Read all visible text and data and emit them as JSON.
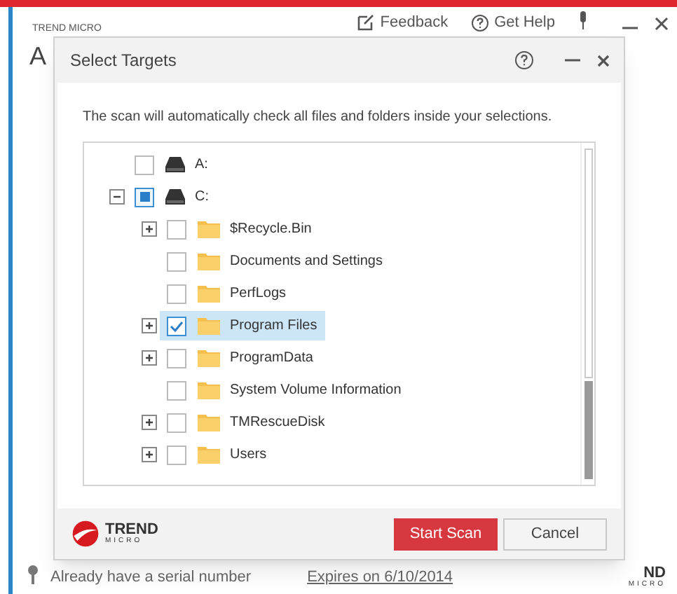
{
  "background_window": {
    "brand": "TREND MICRO",
    "title": "A",
    "header_links": [
      {
        "kind": "feedback",
        "label": "Feedback"
      },
      {
        "kind": "help",
        "label": "Get Help"
      }
    ],
    "serial_link": "Already have a serial number",
    "expiry": "Expires on 6/10/2014",
    "logo_text": "ND",
    "logo_subtext": "MICRO"
  },
  "dialog": {
    "title": "Select Targets",
    "description": "The scan will automatically check all files and folders inside your selections.",
    "tree": [
      {
        "kind": "drive",
        "label": "A:",
        "checked": false,
        "selected": false
      },
      {
        "kind": "drive",
        "label": "C:",
        "checked": false,
        "partial": true,
        "selected": false,
        "expanded": true,
        "children": [
          {
            "kind": "folder",
            "label": "$Recycle.Bin",
            "checked": false,
            "selected": false,
            "expanded": false
          },
          {
            "kind": "folder",
            "label": "Documents and Settings",
            "checked": false,
            "selected": false
          },
          {
            "kind": "folder",
            "label": "PerfLogs",
            "checked": false,
            "selected": false
          },
          {
            "kind": "folder",
            "label": "Program Files",
            "checked": true,
            "selected": true,
            "expanded": false
          },
          {
            "kind": "folder",
            "label": "ProgramData",
            "checked": false,
            "selected": false,
            "expanded": false
          },
          {
            "kind": "folder",
            "label": "System Volume Information",
            "checked": false,
            "selected": false
          },
          {
            "kind": "folder",
            "label": "TMRescueDisk",
            "checked": false,
            "selected": false,
            "expanded": false
          },
          {
            "kind": "folder",
            "label": "Users",
            "checked": false,
            "selected": false,
            "expanded": false
          }
        ]
      }
    ],
    "logo_text": "TREND",
    "logo_subtext": "MICRO",
    "buttons": [
      {
        "kind": "primary",
        "label": "Start Scan"
      },
      {
        "kind": "secondary",
        "label": "Cancel"
      }
    ]
  }
}
